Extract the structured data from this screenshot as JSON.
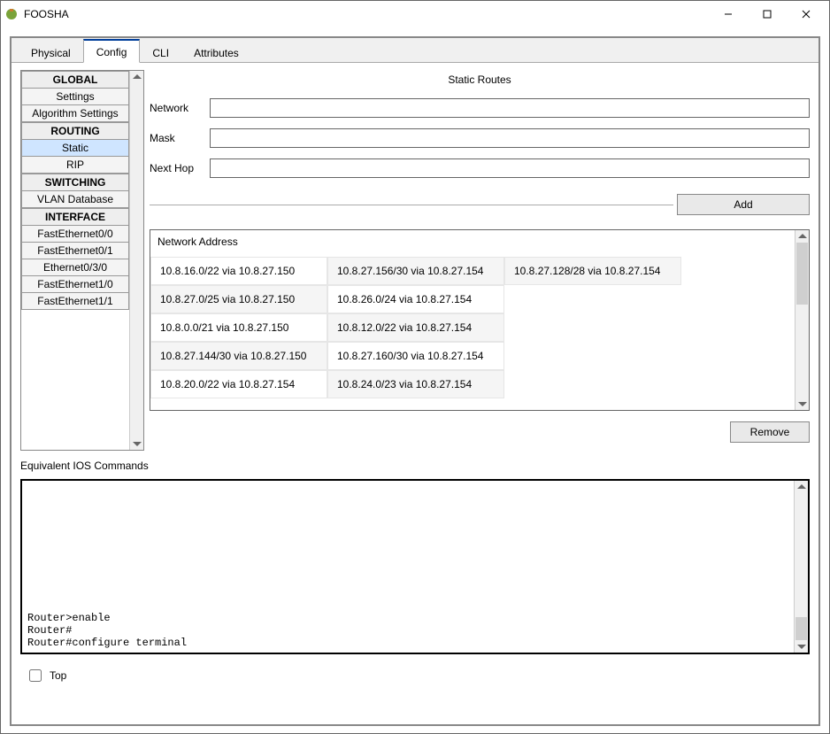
{
  "window": {
    "title": "FOOSHA"
  },
  "tabs": [
    "Physical",
    "Config",
    "CLI",
    "Attributes"
  ],
  "active_tab_index": 1,
  "sidebar": {
    "groups": [
      {
        "header": "GLOBAL",
        "items": [
          "Settings",
          "Algorithm Settings"
        ]
      },
      {
        "header": "ROUTING",
        "items": [
          "Static",
          "RIP"
        ]
      },
      {
        "header": "SWITCHING",
        "items": [
          "VLAN Database"
        ]
      },
      {
        "header": "INTERFACE",
        "items": [
          "FastEthernet0/0",
          "FastEthernet0/1",
          "Ethernet0/3/0",
          "FastEthernet1/0",
          "FastEthernet1/1"
        ]
      }
    ],
    "selected": "Static"
  },
  "panel": {
    "title": "Static Routes",
    "fields": {
      "network": "Network",
      "mask": "Mask",
      "nexthop": "Next Hop"
    },
    "values": {
      "network": "",
      "mask": "",
      "nexthop": ""
    },
    "add_label": "Add",
    "remove_label": "Remove",
    "list_header": "Network Address",
    "routes_columns": [
      [
        "10.8.16.0/22 via 10.8.27.150",
        "10.8.27.0/25 via 10.8.27.150",
        "10.8.0.0/21 via 10.8.27.150",
        "10.8.27.144/30 via 10.8.27.150",
        "10.8.20.0/22 via 10.8.27.154"
      ],
      [
        "10.8.27.156/30 via 10.8.27.154",
        "10.8.26.0/24 via 10.8.27.154",
        "10.8.12.0/22 via 10.8.27.154",
        "10.8.27.160/30 via 10.8.27.154",
        "10.8.24.0/23 via 10.8.27.154"
      ],
      [
        "10.8.27.128/28 via 10.8.27.154"
      ]
    ]
  },
  "ios": {
    "label": "Equivalent IOS Commands",
    "lines": [
      "Router>enable",
      "Router#",
      "Router#configure terminal"
    ]
  },
  "footer": {
    "top_label": "Top",
    "top_checked": false
  }
}
